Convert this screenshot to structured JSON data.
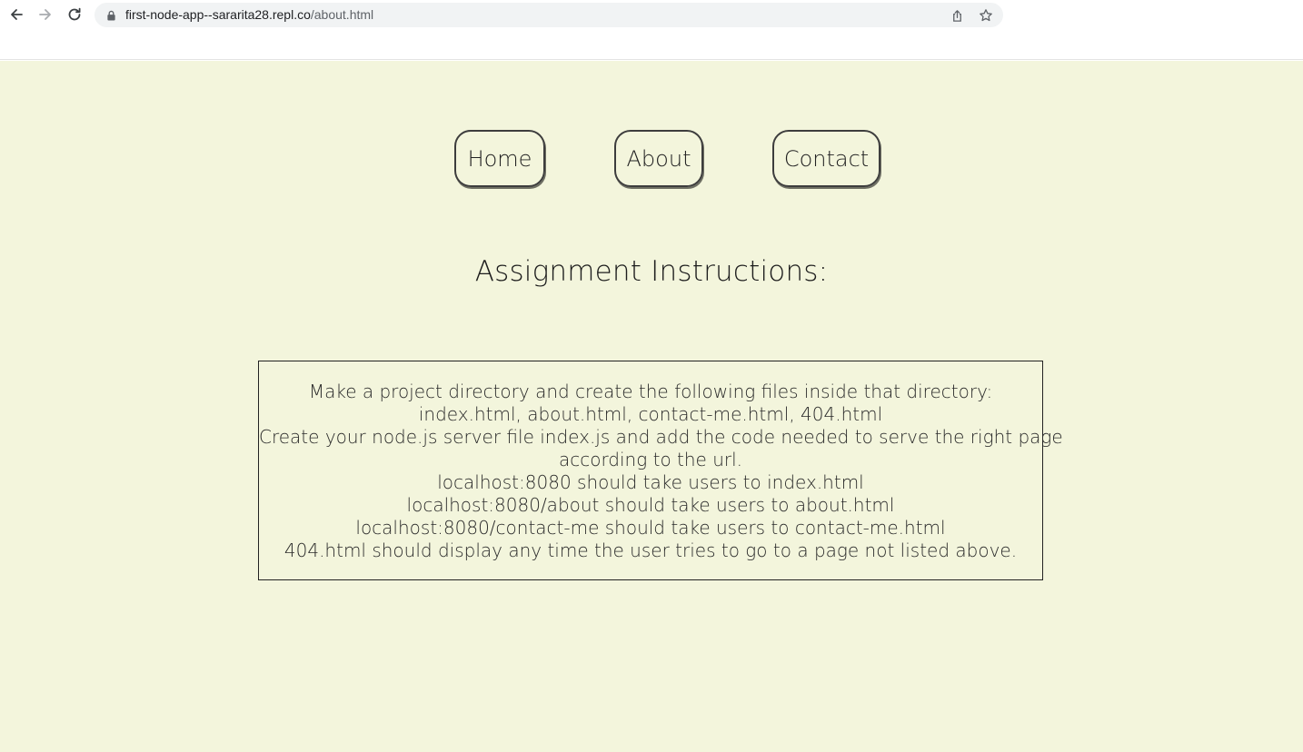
{
  "browser": {
    "url_host": "first-node-app--sararita28.repl.co",
    "url_path": "/about.html",
    "icons": {
      "back": "arrow-left-icon",
      "forward": "arrow-right-icon",
      "reload": "reload-icon",
      "lock": "lock-icon",
      "share": "share-icon",
      "bookmark": "star-icon"
    }
  },
  "nav": {
    "home_label": "Home",
    "about_label": "About",
    "contact_label": "Contact"
  },
  "main": {
    "heading": "Assignment Instructions:",
    "instructions": [
      "Make a project directory and create the following files inside that directory:",
      "index.html, about.html, contact-me.html, 404.html",
      "Create your node.js server file index.js and add the code needed to serve the right page",
      "according to the url.",
      "localhost:8080 should take users to index.html",
      "localhost:8080/about should take users to about.html",
      "localhost:8080/contact-me should take users to contact-me.html",
      "404.html should display any time the user tries to go to a page not listed above."
    ]
  },
  "colors": {
    "page_background": "#f3f5dc",
    "text": "#222222",
    "border": "#3d3d3d",
    "omnibox": "#f1f3f4"
  }
}
